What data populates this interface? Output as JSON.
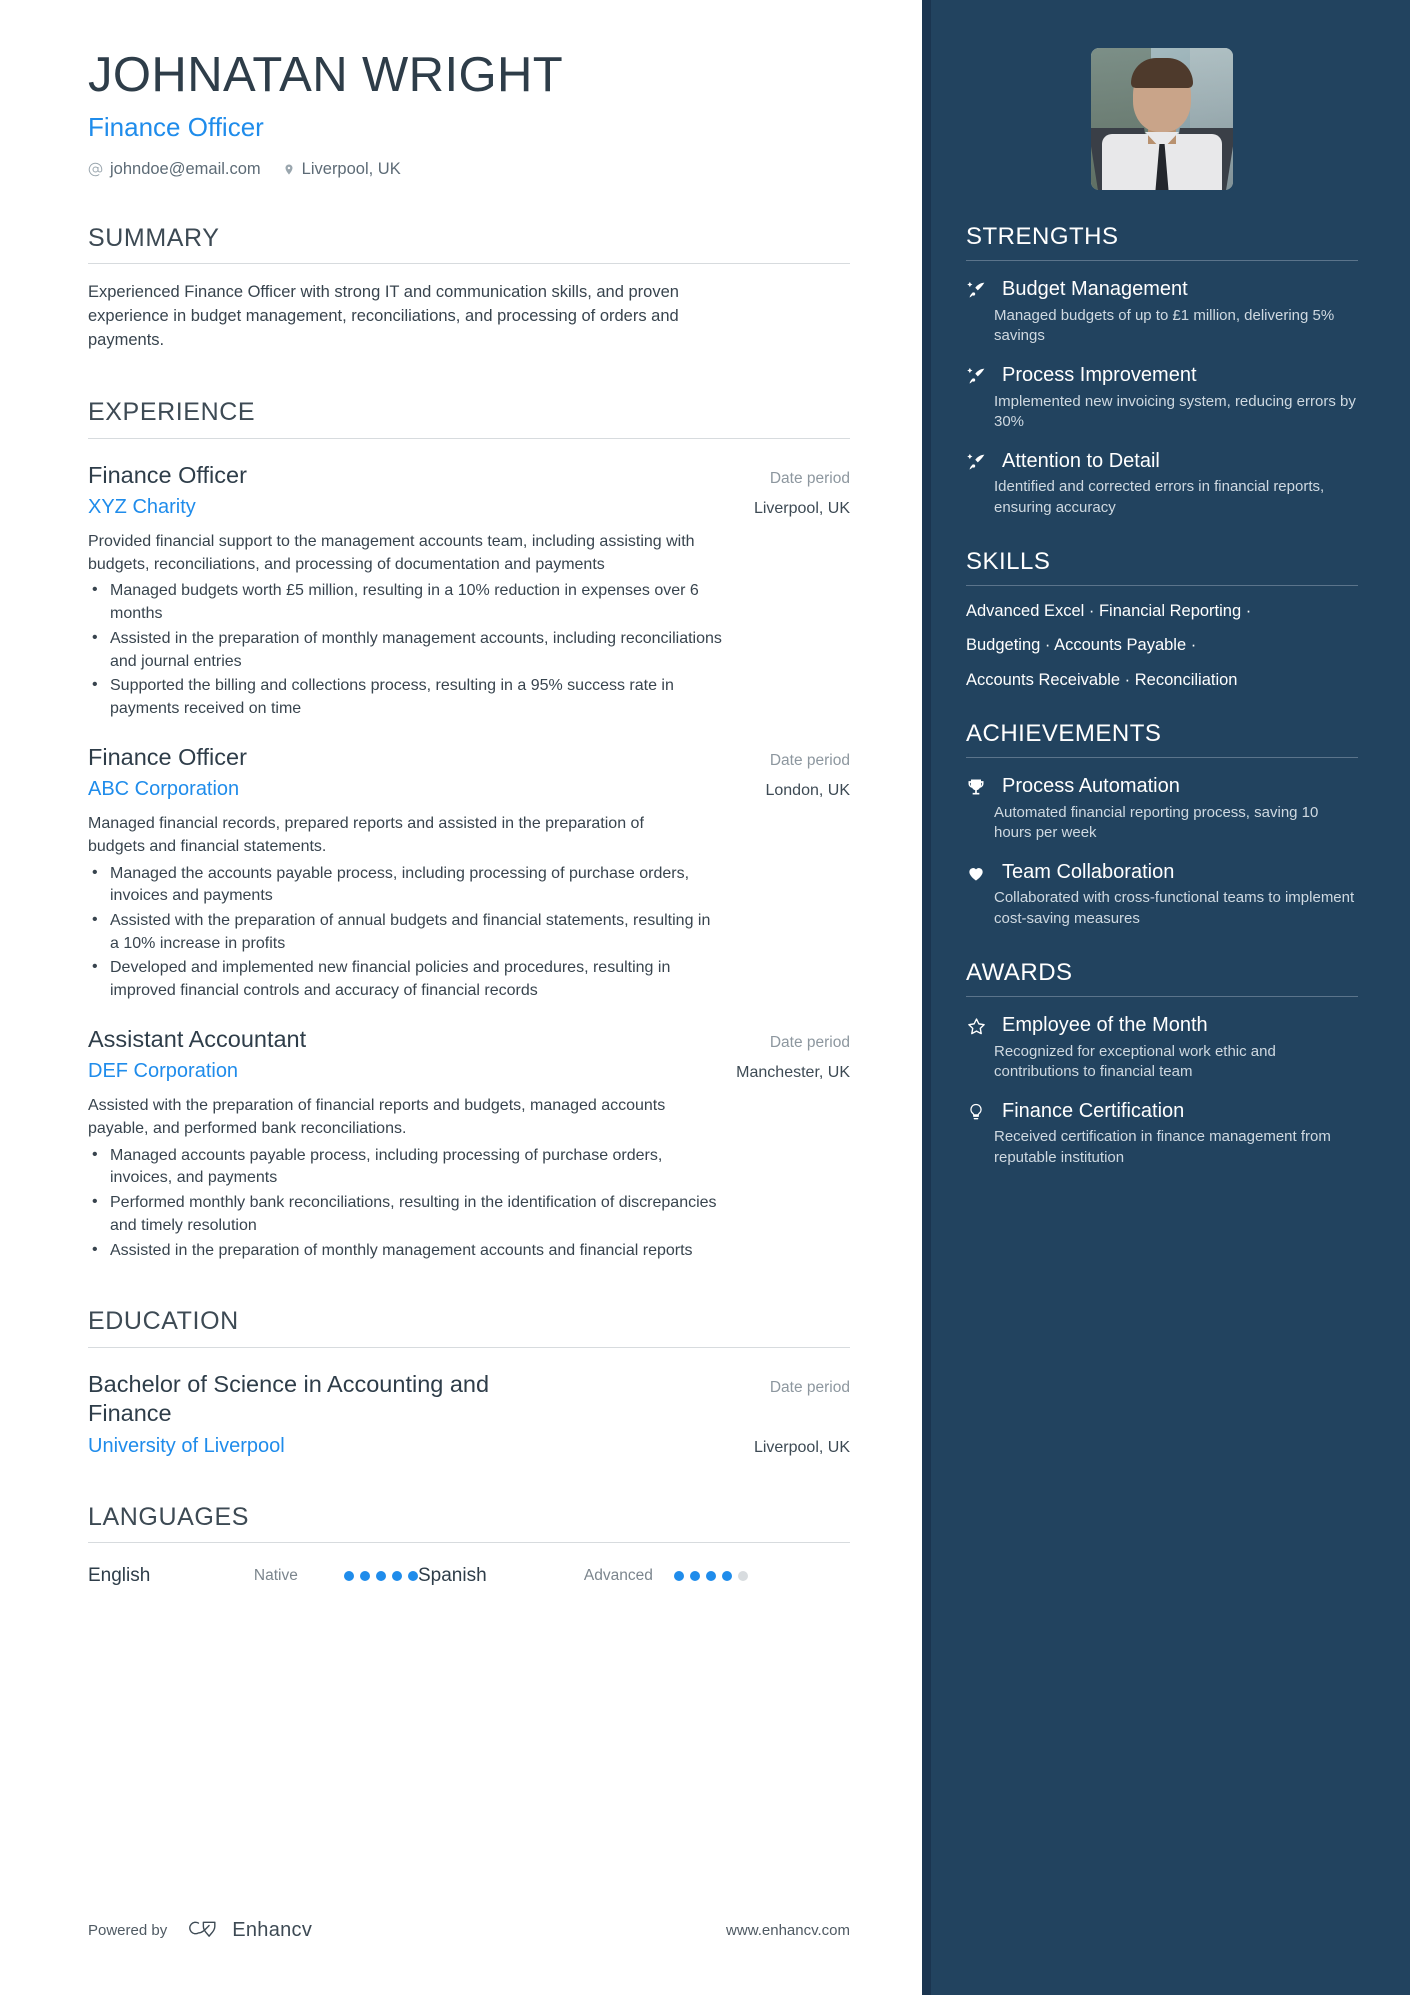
{
  "header": {
    "name": "JOHNATAN WRIGHT",
    "role": "Finance Officer",
    "email": "johndoe@email.com",
    "location": "Liverpool, UK",
    "email_icon": "at-icon",
    "location_icon": "map-pin-icon",
    "accent_color": "#1f8ceb",
    "sidebar_color": "#22435f"
  },
  "summary": {
    "title": "SUMMARY",
    "text": "Experienced Finance Officer with strong IT and communication skills, and proven experience in budget management, reconciliations, and processing of orders and payments."
  },
  "experience": {
    "title": "EXPERIENCE",
    "entries": [
      {
        "job_title": "Finance Officer",
        "date": "Date period",
        "organization": "XYZ Charity",
        "location": "Liverpool, UK",
        "description": "Provided financial support to the management accounts team, including assisting with budgets, reconciliations, and processing of documentation and payments",
        "bullets": [
          "Managed budgets worth £5 million, resulting in a 10% reduction in expenses over 6 months",
          "Assisted in the preparation of monthly management accounts, including reconciliations and journal entries",
          "Supported the billing and collections process, resulting in a 95% success rate in payments received on time"
        ]
      },
      {
        "job_title": "Finance Officer",
        "date": "Date period",
        "organization": "ABC Corporation",
        "location": "London, UK",
        "description": "Managed financial records, prepared reports and assisted in the preparation of budgets and financial statements.",
        "bullets": [
          "Managed the accounts payable process, including processing of purchase orders, invoices and payments",
          "Assisted with the preparation of annual budgets and financial statements, resulting in a 10% increase in profits",
          "Developed and implemented new financial policies and procedures, resulting in improved financial controls and accuracy of financial records"
        ]
      },
      {
        "job_title": "Assistant Accountant",
        "date": "Date period",
        "organization": "DEF Corporation",
        "location": "Manchester, UK",
        "description": "Assisted with the preparation of financial reports and budgets, managed accounts payable, and performed bank reconciliations.",
        "bullets": [
          "Managed accounts payable process, including processing of purchase orders, invoices, and payments",
          "Performed monthly bank reconciliations, resulting in the identification of discrepancies and timely resolution",
          "Assisted in the preparation of monthly management accounts and financial reports"
        ]
      }
    ]
  },
  "education": {
    "title": "EDUCATION",
    "entries": [
      {
        "degree": "Bachelor of Science in Accounting and Finance",
        "date": "Date period",
        "school": "University of Liverpool",
        "location": "Liverpool, UK"
      }
    ]
  },
  "languages": {
    "title": "LANGUAGES",
    "items": [
      {
        "name": "English",
        "level": "Native",
        "filled": 5,
        "total": 5
      },
      {
        "name": "Spanish",
        "level": "Advanced",
        "filled": 4,
        "total": 5
      }
    ]
  },
  "footer": {
    "powered_label": "Powered by",
    "brand": "Enhancv",
    "brand_icon": "enhancv-logo-icon",
    "website": "www.enhancv.com"
  },
  "strengths": {
    "title": "STRENGTHS",
    "icon": "rocket-arrow-icon",
    "items": [
      {
        "title": "Budget Management",
        "desc": "Managed budgets of up to £1 million, delivering 5% savings"
      },
      {
        "title": "Process Improvement",
        "desc": "Implemented new invoicing system, reducing errors by 30%"
      },
      {
        "title": "Attention to Detail",
        "desc": "Identified and corrected errors in financial reports, ensuring accuracy"
      }
    ]
  },
  "skills": {
    "title": "SKILLS",
    "lines": [
      "Advanced Excel · Financial Reporting ·",
      "Budgeting · Accounts Payable ·",
      "Accounts Receivable · Reconciliation"
    ]
  },
  "achievements": {
    "title": "ACHIEVEMENTS",
    "items": [
      {
        "icon": "trophy-icon",
        "title": "Process Automation",
        "desc": "Automated financial reporting process, saving 10 hours per week"
      },
      {
        "icon": "heart-icon",
        "title": "Team Collaboration",
        "desc": "Collaborated with cross-functional teams to implement cost-saving measures"
      }
    ]
  },
  "awards": {
    "title": "AWARDS",
    "items": [
      {
        "icon": "star-icon",
        "title": "Employee of the Month",
        "desc": "Recognized for exceptional work ethic and contributions to financial team"
      },
      {
        "icon": "lightbulb-icon",
        "title": "Finance Certification",
        "desc": "Received certification in finance management from reputable institution"
      }
    ]
  }
}
